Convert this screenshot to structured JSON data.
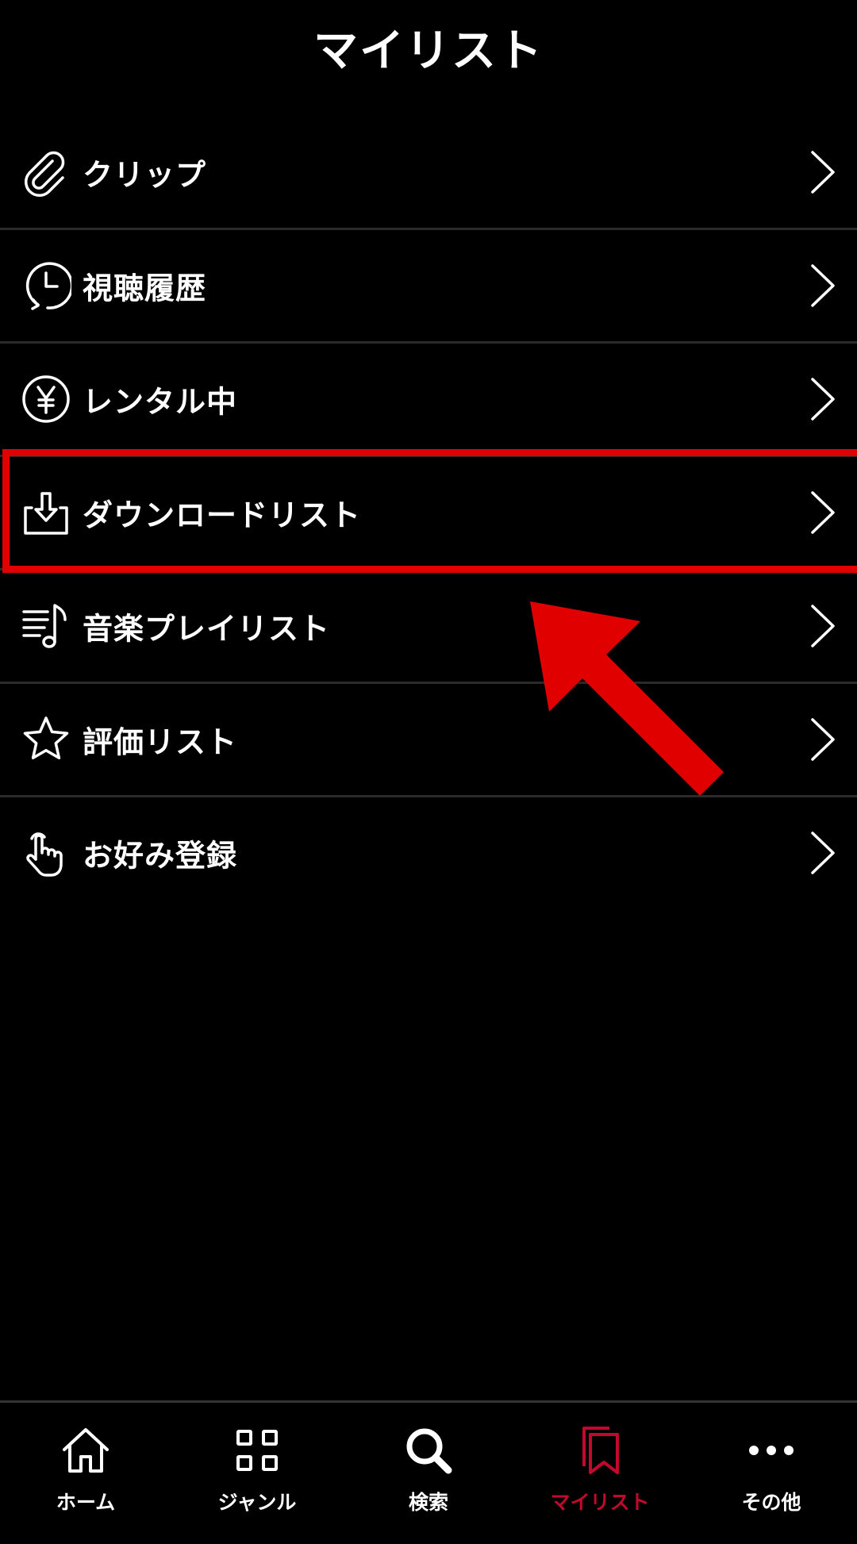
{
  "header": {
    "title": "マイリスト"
  },
  "menu": {
    "items": [
      {
        "label": "クリップ",
        "icon": "paperclip-icon"
      },
      {
        "label": "視聴履歴",
        "icon": "history-clock-icon"
      },
      {
        "label": "レンタル中",
        "icon": "yen-coin-icon"
      },
      {
        "label": "ダウンロードリスト",
        "icon": "download-tray-icon"
      },
      {
        "label": "音楽プレイリスト",
        "icon": "music-playlist-icon"
      },
      {
        "label": "評価リスト",
        "icon": "star-icon"
      },
      {
        "label": "お好み登録",
        "icon": "tap-hand-icon"
      }
    ],
    "highlighted_index": 3
  },
  "bottom_nav": {
    "items": [
      {
        "label": "ホーム",
        "icon": "home-icon"
      },
      {
        "label": "ジャンル",
        "icon": "grid-icon"
      },
      {
        "label": "検索",
        "icon": "search-icon"
      },
      {
        "label": "マイリスト",
        "icon": "bookmark-stack-icon"
      },
      {
        "label": "その他",
        "icon": "more-dots-icon"
      }
    ],
    "active_index": 3
  },
  "colors": {
    "background": "#000000",
    "text": "#ffffff",
    "active_accent": "#c2092b",
    "highlight": "#e00000",
    "divider": "#2a2a2a"
  }
}
